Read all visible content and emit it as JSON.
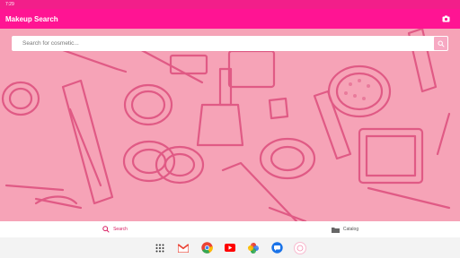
{
  "status": {
    "time": "7:29"
  },
  "app": {
    "title": "Makeup Search"
  },
  "search": {
    "placeholder": "Search for cosmetic..."
  },
  "nav": {
    "items": [
      {
        "label": "Search"
      },
      {
        "label": "Catalog"
      }
    ]
  },
  "taskbar": {
    "apps": [
      "apps-grid-icon",
      "gmail-icon",
      "chrome-icon",
      "youtube-icon",
      "photos-icon",
      "messages-icon",
      "makeup-app-icon"
    ]
  },
  "colors": {
    "accent": "#ff1493",
    "background": "#f6a3b7",
    "nav_active": "#d81b60"
  }
}
